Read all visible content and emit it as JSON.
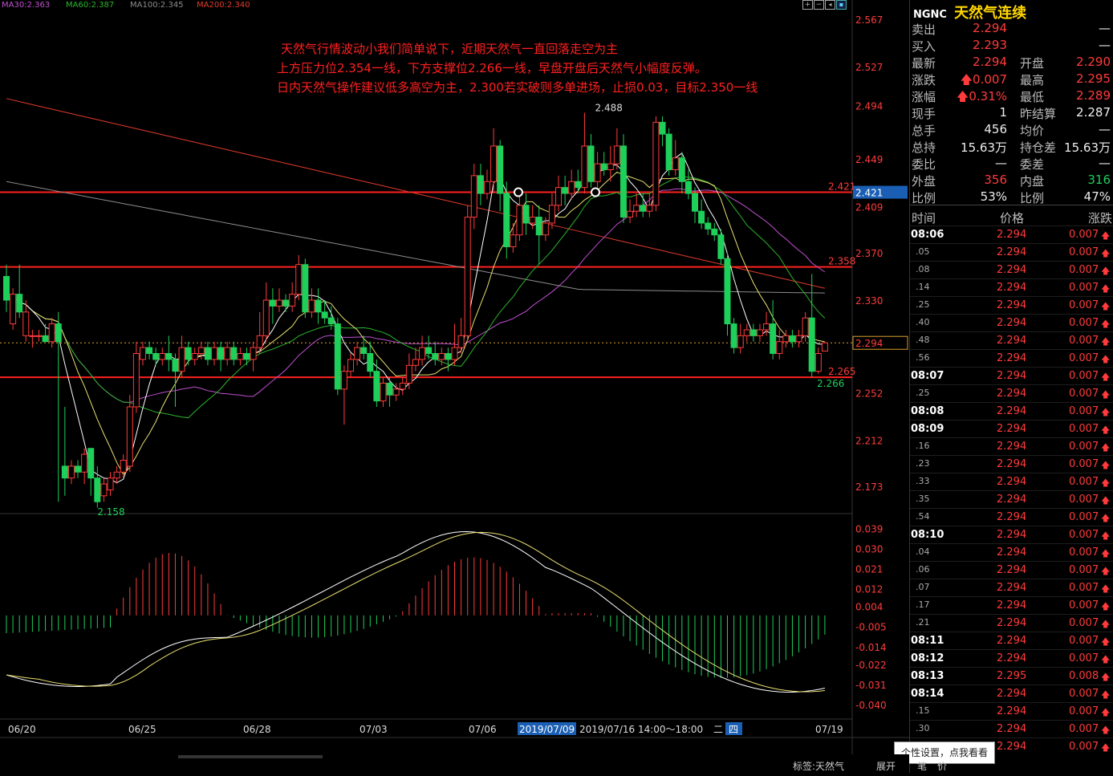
{
  "ma_legend": {
    "ma30": "MA30:2.363",
    "ma60": "MA60:2.387",
    "ma100": "MA100:2.345",
    "ma200": "MA200:2.340"
  },
  "annotation": [
    "天然气行情波动小我们简单说下，近期天然气一直回落走空为主",
    "上方压力位2.354一线，下方支撑位2.266一线，早盘开盘后天然气小幅度反弹。",
    "日内天然气操作建议低多高空为主，2.300若实破则多单进场，止损0.03，目标2.350一线"
  ],
  "price_ticks": [
    "2.567",
    "2.527",
    "2.494",
    "2.449",
    "2.409",
    "2.370",
    "2.330",
    "2.252",
    "2.212",
    "2.173"
  ],
  "macd_ticks": [
    "0.039",
    "0.030",
    "0.021",
    "0.012",
    "0.004",
    "-0.005",
    "-0.014",
    "-0.022",
    "-0.031",
    "-0.040"
  ],
  "date_labels": [
    "06/20",
    "06/25",
    "06/28",
    "07/03",
    "07/06",
    "07/19"
  ],
  "bottom_info": {
    "date1": "2019/07/09",
    "date2": "2019/07/16 14:00～18:00",
    "day1": "二",
    "day2": "四"
  },
  "level_labels": {
    "r2": "2.421",
    "r1": "2.358",
    "s1": "2.265",
    "current": "2.294",
    "cur_tag": "2.421",
    "high": "2.488",
    "low": "2.158",
    "low2": "2.266"
  },
  "colors": {
    "up": "#ff3b3b",
    "down": "#1ecf5a",
    "ma30": "#c050d0",
    "ma60": "#2bb52b",
    "ma100": "#8c8c8c",
    "ma200": "#e03a2a"
  },
  "status_bar": {
    "tag": "标签:天然气",
    "tab1": "展开",
    "tab2": "笔",
    "tab3": "价"
  },
  "tooltip": "个性设置，点我看看",
  "quote": {
    "symbol": "NGNC",
    "name": "天然气连续",
    "rows": [
      {
        "l1": "卖出",
        "v1": "2.294",
        "c1": "red",
        "l2": "",
        "v2": "—",
        "c2": "wht"
      },
      {
        "l1": "买入",
        "v1": "2.293",
        "c1": "red",
        "l2": "",
        "v2": "—",
        "c2": "wht"
      },
      {
        "l1": "最新",
        "v1": "2.294",
        "c1": "red",
        "l2": "开盘",
        "v2": "2.290",
        "c2": "red"
      },
      {
        "l1": "涨跌",
        "v1": "🡅0.007",
        "c1": "red",
        "l2": "最高",
        "v2": "2.295",
        "c2": "red"
      },
      {
        "l1": "涨幅",
        "v1": "🡅0.31%",
        "c1": "red",
        "l2": "最低",
        "v2": "2.289",
        "c2": "red"
      },
      {
        "l1": "现手",
        "v1": "1",
        "c1": "wht",
        "l2": "昨结算",
        "v2": "2.287",
        "c2": "wht"
      },
      {
        "l1": "总手",
        "v1": "456",
        "c1": "wht",
        "l2": "均价",
        "v2": "—",
        "c2": "wht"
      },
      {
        "l1": "总持",
        "v1": "15.63万",
        "c1": "wht",
        "l2": "持仓差",
        "v2": "15.63万",
        "c2": "wht"
      },
      {
        "l1": "委比",
        "v1": "—",
        "c1": "wht",
        "l2": "委差",
        "v2": "—",
        "c2": "wht"
      },
      {
        "l1": "外盘",
        "v1": "356",
        "c1": "red",
        "l2": "内盘",
        "v2": "316",
        "c2": "grn"
      },
      {
        "l1": "比例",
        "v1": "53%",
        "c1": "wht",
        "l2": "比例",
        "v2": "47%",
        "c2": "wht"
      }
    ],
    "ticks_header": {
      "time": "时间",
      "price": "价格",
      "change": "涨跌"
    },
    "ticks": [
      {
        "t": "08:06",
        "p": "2.294",
        "c": "0.007",
        "bold": true
      },
      {
        "t": ".05",
        "p": "2.294",
        "c": "0.007",
        "bold": false
      },
      {
        "t": ".08",
        "p": "2.294",
        "c": "0.007",
        "bold": false
      },
      {
        "t": ".14",
        "p": "2.294",
        "c": "0.007",
        "bold": false
      },
      {
        "t": ".25",
        "p": "2.294",
        "c": "0.007",
        "bold": false
      },
      {
        "t": ".40",
        "p": "2.294",
        "c": "0.007",
        "bold": false
      },
      {
        "t": ".48",
        "p": "2.294",
        "c": "0.007",
        "bold": false
      },
      {
        "t": ".56",
        "p": "2.294",
        "c": "0.007",
        "bold": false
      },
      {
        "t": "08:07",
        "p": "2.294",
        "c": "0.007",
        "bold": true
      },
      {
        "t": ".25",
        "p": "2.294",
        "c": "0.007",
        "bold": false
      },
      {
        "t": "08:08",
        "p": "2.294",
        "c": "0.007",
        "bold": true
      },
      {
        "t": "08:09",
        "p": "2.294",
        "c": "0.007",
        "bold": true
      },
      {
        "t": ".16",
        "p": "2.294",
        "c": "0.007",
        "bold": false
      },
      {
        "t": ".23",
        "p": "2.294",
        "c": "0.007",
        "bold": false
      },
      {
        "t": ".33",
        "p": "2.294",
        "c": "0.007",
        "bold": false
      },
      {
        "t": ".35",
        "p": "2.294",
        "c": "0.007",
        "bold": false
      },
      {
        "t": ".54",
        "p": "2.294",
        "c": "0.007",
        "bold": false
      },
      {
        "t": "08:10",
        "p": "2.294",
        "c": "0.007",
        "bold": true
      },
      {
        "t": ".04",
        "p": "2.294",
        "c": "0.007",
        "bold": false
      },
      {
        "t": ".06",
        "p": "2.294",
        "c": "0.007",
        "bold": false
      },
      {
        "t": ".07",
        "p": "2.294",
        "c": "0.007",
        "bold": false
      },
      {
        "t": ".17",
        "p": "2.294",
        "c": "0.007",
        "bold": false
      },
      {
        "t": ".21",
        "p": "2.294",
        "c": "0.007",
        "bold": false
      },
      {
        "t": "08:11",
        "p": "2.294",
        "c": "0.007",
        "bold": true
      },
      {
        "t": "08:12",
        "p": "2.294",
        "c": "0.007",
        "bold": true
      },
      {
        "t": "08:13",
        "p": "2.295",
        "c": "0.008",
        "bold": true
      },
      {
        "t": "08:14",
        "p": "2.294",
        "c": "0.007",
        "bold": true
      },
      {
        "t": ".15",
        "p": "2.294",
        "c": "0.007",
        "bold": false
      },
      {
        "t": ".30",
        "p": "2.294",
        "c": "0.007",
        "bold": false
      },
      {
        "t": ".34",
        "p": "2.294",
        "c": "0.007",
        "bold": false
      }
    ]
  },
  "chart_data": {
    "type": "candlestick",
    "title": "",
    "price_range": [
      2.15,
      2.575
    ],
    "horizontal_levels": [
      2.421,
      2.358,
      2.265
    ],
    "current_price": 2.294,
    "x_labels": [
      "06/20",
      "06/25",
      "06/28",
      "07/03",
      "07/06",
      "07/19"
    ],
    "candles": [
      [
        2.35,
        2.33,
        2.36,
        2.32
      ],
      [
        2.31,
        2.335,
        2.34,
        2.305
      ],
      [
        2.335,
        2.32,
        2.36,
        2.315
      ],
      [
        2.3,
        2.32,
        2.33,
        2.295
      ],
      [
        2.3,
        2.3,
        2.305,
        2.29
      ],
      [
        2.3,
        2.3,
        2.305,
        2.295
      ],
      [
        2.3,
        2.295,
        2.31,
        2.295
      ],
      [
        2.295,
        2.31,
        2.315,
        2.29
      ],
      [
        2.31,
        2.295,
        2.32,
        2.16
      ],
      [
        2.19,
        2.18,
        2.24,
        2.165
      ],
      [
        2.18,
        2.19,
        2.195,
        2.175
      ],
      [
        2.19,
        2.185,
        2.195,
        2.18
      ],
      [
        2.185,
        2.2,
        2.205,
        2.175
      ],
      [
        2.205,
        2.18,
        2.205,
        2.165
      ],
      [
        2.18,
        2.16,
        2.19,
        2.155
      ],
      [
        2.165,
        2.175,
        2.18,
        2.16
      ],
      [
        2.17,
        2.18,
        2.185,
        2.165
      ],
      [
        2.18,
        2.185,
        2.19,
        2.175
      ],
      [
        2.185,
        2.195,
        2.2,
        2.18
      ],
      [
        2.19,
        2.24,
        2.25,
        2.185
      ],
      [
        2.24,
        2.285,
        2.295,
        2.235
      ],
      [
        2.28,
        2.29,
        2.295,
        2.275
      ],
      [
        2.29,
        2.285,
        2.295,
        2.28
      ],
      [
        2.285,
        2.28,
        2.29,
        2.275
      ],
      [
        2.28,
        2.285,
        2.29,
        2.275
      ],
      [
        2.285,
        2.28,
        2.3,
        2.27
      ],
      [
        2.28,
        2.27,
        2.285,
        2.24
      ],
      [
        2.27,
        2.29,
        2.3,
        2.265
      ],
      [
        2.29,
        2.28,
        2.295,
        2.275
      ],
      [
        2.28,
        2.285,
        2.29,
        2.275
      ],
      [
        2.285,
        2.29,
        2.295,
        2.28
      ],
      [
        2.29,
        2.28,
        2.295,
        2.275
      ],
      [
        2.28,
        2.29,
        2.295,
        2.275
      ],
      [
        2.29,
        2.28,
        2.295,
        2.27
      ],
      [
        2.28,
        2.29,
        2.295,
        2.275
      ],
      [
        2.29,
        2.28,
        2.295,
        2.275
      ],
      [
        2.28,
        2.285,
        2.29,
        2.275
      ],
      [
        2.285,
        2.28,
        2.29,
        2.275
      ],
      [
        2.28,
        2.29,
        2.295,
        2.27
      ],
      [
        2.29,
        2.3,
        2.32,
        2.285
      ],
      [
        2.3,
        2.33,
        2.345,
        2.295
      ],
      [
        2.33,
        2.325,
        2.34,
        2.31
      ],
      [
        2.325,
        2.33,
        2.34,
        2.32
      ],
      [
        2.33,
        2.325,
        2.335,
        2.32
      ],
      [
        2.325,
        2.335,
        2.345,
        2.32
      ],
      [
        2.335,
        2.36,
        2.368,
        2.33
      ],
      [
        2.36,
        2.32,
        2.365,
        2.315
      ],
      [
        2.32,
        2.33,
        2.34,
        2.315
      ],
      [
        2.33,
        2.32,
        2.34,
        2.31
      ],
      [
        2.32,
        2.315,
        2.33,
        2.31
      ],
      [
        2.315,
        2.31,
        2.325,
        2.305
      ],
      [
        2.31,
        2.255,
        2.315,
        2.25
      ],
      [
        2.255,
        2.27,
        2.275,
        2.225
      ],
      [
        2.27,
        2.28,
        2.285,
        2.265
      ],
      [
        2.28,
        2.29,
        2.295,
        2.275
      ],
      [
        2.29,
        2.285,
        2.3,
        2.28
      ],
      [
        2.285,
        2.27,
        2.295,
        2.265
      ],
      [
        2.27,
        2.245,
        2.28,
        2.24
      ],
      [
        2.245,
        2.26,
        2.265,
        2.24
      ],
      [
        2.26,
        2.25,
        2.265,
        2.24
      ],
      [
        2.25,
        2.255,
        2.26,
        2.245
      ],
      [
        2.255,
        2.26,
        2.265,
        2.25
      ],
      [
        2.26,
        2.275,
        2.285,
        2.255
      ],
      [
        2.275,
        2.28,
        2.29,
        2.27
      ],
      [
        2.28,
        2.29,
        2.3,
        2.275
      ],
      [
        2.29,
        2.285,
        2.3,
        2.28
      ],
      [
        2.285,
        2.28,
        2.295,
        2.275
      ],
      [
        2.28,
        2.285,
        2.29,
        2.275
      ],
      [
        2.285,
        2.28,
        2.29,
        2.27
      ],
      [
        2.28,
        2.29,
        2.31,
        2.275
      ],
      [
        2.29,
        2.3,
        2.315,
        2.285
      ],
      [
        2.3,
        2.4,
        2.41,
        2.295
      ],
      [
        2.4,
        2.435,
        2.445,
        2.39
      ],
      [
        2.435,
        2.42,
        2.445,
        2.41
      ],
      [
        2.42,
        2.43,
        2.44,
        2.415
      ],
      [
        2.43,
        2.46,
        2.475,
        2.42
      ],
      [
        2.46,
        2.42,
        2.465,
        2.405
      ],
      [
        2.42,
        2.375,
        2.43,
        2.365
      ],
      [
        2.375,
        2.385,
        2.395,
        2.37
      ],
      [
        2.385,
        2.41,
        2.42,
        2.38
      ],
      [
        2.41,
        2.395,
        2.42,
        2.385
      ],
      [
        2.395,
        2.4,
        2.41,
        2.39
      ],
      [
        2.4,
        2.385,
        2.41,
        2.36
      ],
      [
        2.385,
        2.395,
        2.4,
        2.38
      ],
      [
        2.395,
        2.41,
        2.42,
        2.39
      ],
      [
        2.41,
        2.425,
        2.435,
        2.405
      ],
      [
        2.425,
        2.42,
        2.435,
        2.41
      ],
      [
        2.42,
        2.43,
        2.44,
        2.415
      ],
      [
        2.43,
        2.425,
        2.44,
        2.42
      ],
      [
        2.425,
        2.46,
        2.488,
        2.42
      ],
      [
        2.46,
        2.43,
        2.47,
        2.425
      ],
      [
        2.43,
        2.445,
        2.455,
        2.425
      ],
      [
        2.445,
        2.44,
        2.455,
        2.435
      ],
      [
        2.44,
        2.445,
        2.46,
        2.43
      ],
      [
        2.445,
        2.46,
        2.475,
        2.44
      ],
      [
        2.46,
        2.4,
        2.47,
        2.395
      ],
      [
        2.4,
        2.405,
        2.415,
        2.395
      ],
      [
        2.405,
        2.41,
        2.42,
        2.4
      ],
      [
        2.41,
        2.405,
        2.42,
        2.4
      ],
      [
        2.405,
        2.41,
        2.42,
        2.4
      ],
      [
        2.41,
        2.48,
        2.485,
        2.405
      ],
      [
        2.48,
        2.47,
        2.485,
        2.46
      ],
      [
        2.47,
        2.44,
        2.475,
        2.435
      ],
      [
        2.44,
        2.45,
        2.465,
        2.435
      ],
      [
        2.45,
        2.43,
        2.455,
        2.42
      ],
      [
        2.43,
        2.42,
        2.44,
        2.415
      ],
      [
        2.42,
        2.405,
        2.425,
        2.395
      ],
      [
        2.405,
        2.395,
        2.415,
        2.39
      ],
      [
        2.395,
        2.39,
        2.4,
        2.385
      ],
      [
        2.39,
        2.385,
        2.395,
        2.38
      ],
      [
        2.385,
        2.365,
        2.39,
        2.36
      ],
      [
        2.365,
        2.31,
        2.37,
        2.3
      ],
      [
        2.31,
        2.29,
        2.315,
        2.285
      ],
      [
        2.29,
        2.3,
        2.31,
        2.285
      ],
      [
        2.3,
        2.305,
        2.31,
        2.295
      ],
      [
        2.305,
        2.3,
        2.31,
        2.295
      ],
      [
        2.3,
        2.305,
        2.31,
        2.295
      ],
      [
        2.305,
        2.31,
        2.32,
        2.3
      ],
      [
        2.31,
        2.285,
        2.33,
        2.28
      ],
      [
        2.285,
        2.295,
        2.305,
        2.28
      ],
      [
        2.295,
        2.3,
        2.305,
        2.29
      ],
      [
        2.3,
        2.295,
        2.305,
        2.29
      ],
      [
        2.295,
        2.3,
        2.305,
        2.29
      ],
      [
        2.3,
        2.315,
        2.32,
        2.295
      ],
      [
        2.315,
        2.27,
        2.352,
        2.265
      ],
      [
        2.27,
        2.285,
        2.29,
        2.268
      ],
      [
        2.287,
        2.294,
        2.295,
        2.289
      ]
    ]
  }
}
